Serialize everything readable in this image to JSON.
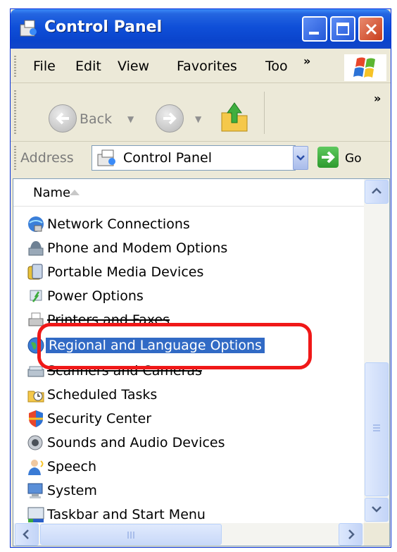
{
  "window": {
    "title": "Control Panel"
  },
  "menu": {
    "items": [
      "File",
      "Edit",
      "View",
      "Favorites",
      "Too"
    ]
  },
  "toolbar": {
    "back_label": "Back"
  },
  "address": {
    "label": "Address",
    "value": "Control Panel",
    "go_label": "Go"
  },
  "list": {
    "column_header": "Name",
    "items": [
      {
        "label": "Network Connections",
        "icon": "network-connections-icon"
      },
      {
        "label": "Phone and Modem Options",
        "icon": "phone-modem-icon"
      },
      {
        "label": "Portable Media Devices",
        "icon": "portable-media-icon"
      },
      {
        "label": "Power Options",
        "icon": "power-options-icon"
      },
      {
        "label": "Printers and Faxes",
        "icon": "printer-icon"
      },
      {
        "label": "Regional and Language Options",
        "icon": "globe-icon"
      },
      {
        "label": "Scanners and Cameras",
        "icon": "scanner-icon"
      },
      {
        "label": "Scheduled Tasks",
        "icon": "scheduled-tasks-icon"
      },
      {
        "label": "Security Center",
        "icon": "shield-icon"
      },
      {
        "label": "Sounds and Audio Devices",
        "icon": "speaker-icon"
      },
      {
        "label": "Speech",
        "icon": "speech-icon"
      },
      {
        "label": "System",
        "icon": "computer-icon"
      },
      {
        "label": "Taskbar and Start Menu",
        "icon": "taskbar-icon"
      }
    ],
    "selected_item": "Regional and Language Options"
  },
  "colors": {
    "selection": "#316AC5",
    "highlight_ring": "#F01818",
    "titlebar": "#0A44CC"
  }
}
